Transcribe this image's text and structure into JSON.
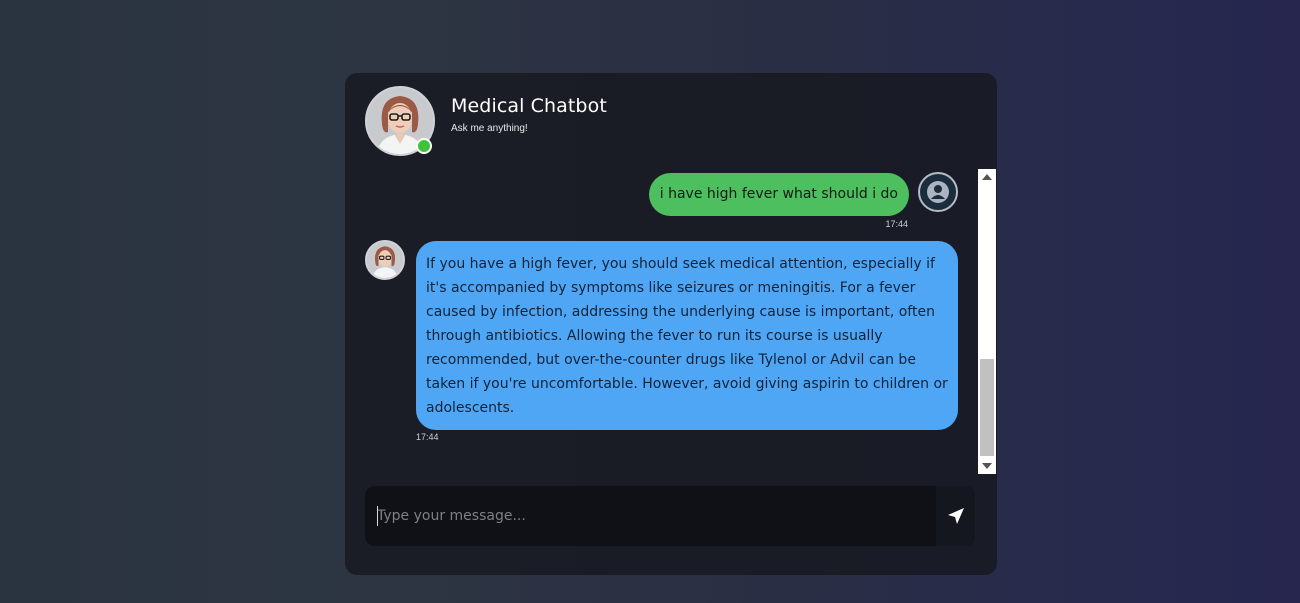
{
  "header": {
    "title": "Medical Chatbot",
    "subtitle": "Ask me anything!",
    "status": "online"
  },
  "messages": [
    {
      "sender": "user",
      "text": "i have high fever what should i do",
      "time": "17:44"
    },
    {
      "sender": "bot",
      "text": "If you have a high fever, you should seek medical attention, especially if it's accompanied by symptoms like seizures or meningitis. For a fever caused by infection, addressing the underlying cause is important, often through antibiotics. Allowing the fever to run its course is usually recommended, but over-the-counter drugs like Tylenol or Advil can be taken if you're uncomfortable. However, avoid giving aspirin to children or adolescents.",
      "time": "17:44"
    }
  ],
  "composer": {
    "placeholder": "Type your message...",
    "value": ""
  },
  "colors": {
    "user_bubble": "#4dbf5f",
    "bot_bubble": "#4ea6f5",
    "online": "#3ec33a",
    "card": "#16191f"
  },
  "icons": {
    "send": "send-icon",
    "user": "user-icon",
    "bot": "doctor-avatar"
  }
}
